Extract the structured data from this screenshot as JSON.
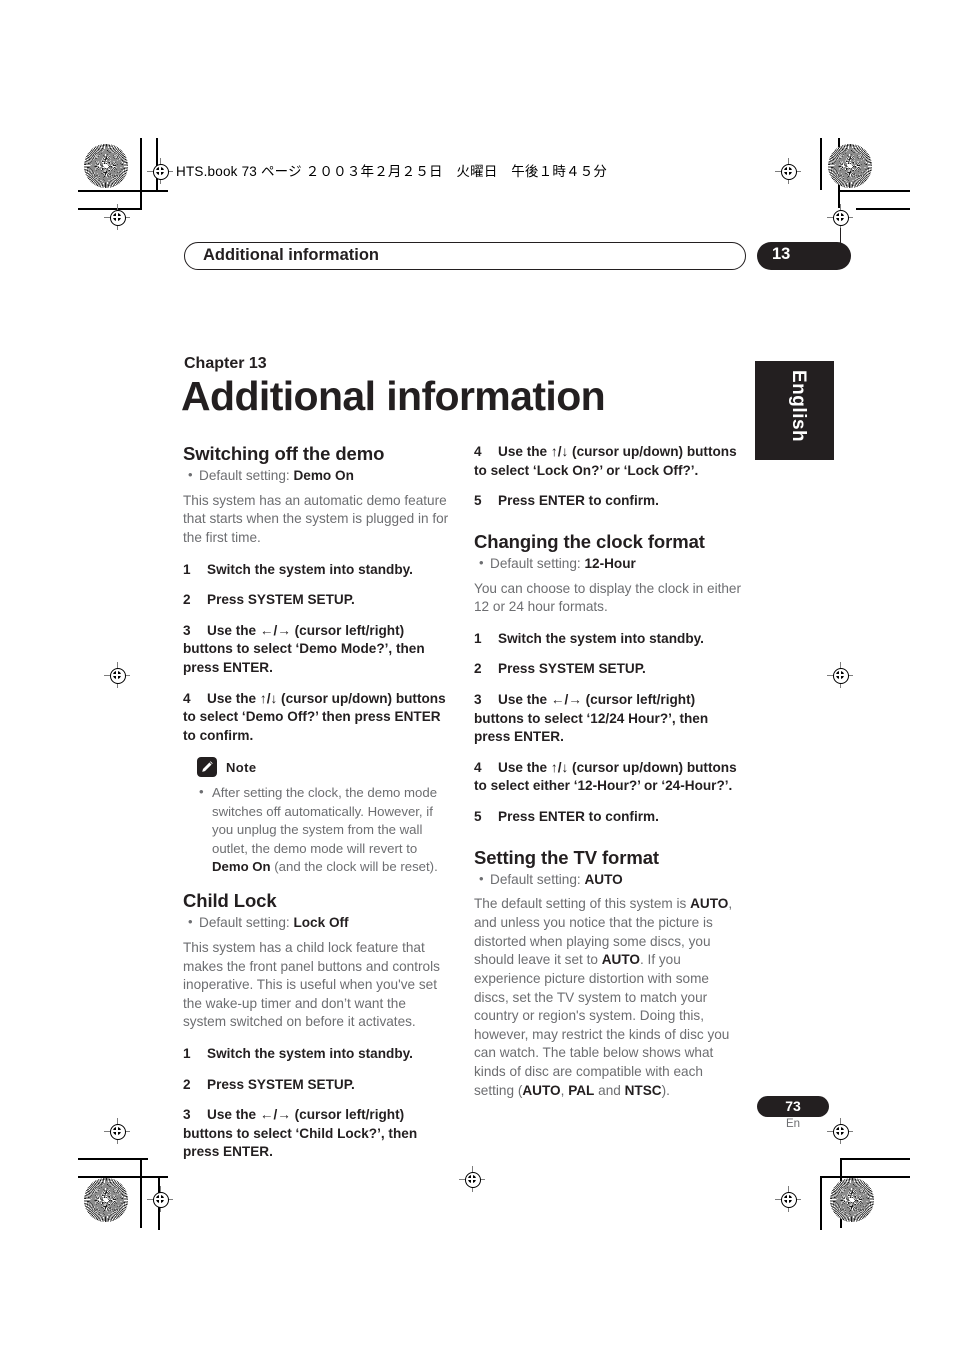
{
  "print_marks": {
    "filename_line": "HTS.book 73 ページ ２００３年２月２５日　火曜日　午後１時４５分"
  },
  "running_head": {
    "title": "Additional information",
    "chapter_number": "13"
  },
  "side_tab": {
    "language": "English"
  },
  "chapter": {
    "label": "Chapter 13",
    "title": "Additional information"
  },
  "left_column": {
    "section1": {
      "heading": "Switching off the demo",
      "default_label": "Default setting: ",
      "default_value": "Demo On",
      "intro": "This system has an automatic demo feature that starts when the system is plugged in for the first time.",
      "steps": [
        {
          "n": "1",
          "text": "Switch the system into standby."
        },
        {
          "n": "2",
          "text": "Press SYSTEM SETUP."
        },
        {
          "n": "3",
          "pre": "Use the ",
          "arrows": "←/→",
          "post": " (cursor left/right) buttons to select ‘Demo Mode?’, then press ENTER."
        },
        {
          "n": "4",
          "pre": "Use the ",
          "arrows": "↑/↓",
          "post": " (cursor up/down) buttons to select ‘Demo Off?’ then press ENTER to confirm."
        }
      ]
    },
    "note": {
      "icon": "pencil-icon",
      "label": "Note",
      "text_part1": "After setting the clock, the demo mode switches off automatically. However, if you unplug the system from the wall outlet, the demo mode will revert to ",
      "text_bold": "Demo On",
      "text_part2": " (and the clock will be reset)."
    },
    "section2": {
      "heading": "Child Lock",
      "default_label": "Default setting: ",
      "default_value": "Lock Off",
      "intro": "This system has a child lock feature that makes the front panel buttons and controls inoperative. This is useful when you've set the wake-up timer and don’t want the system switched on before it activates.",
      "steps": [
        {
          "n": "1",
          "text": "Switch the system into standby."
        },
        {
          "n": "2",
          "text": "Press SYSTEM SETUP."
        },
        {
          "n": "3",
          "pre": "Use the ",
          "arrows": "←/→",
          "post": " (cursor left/right) buttons to select ‘Child Lock?’, then press ENTER."
        }
      ]
    }
  },
  "right_column": {
    "continued_steps": [
      {
        "n": "4",
        "pre": "Use the ",
        "arrows": "↑/↓",
        "post": " (cursor up/down) buttons to select ‘Lock On?’ or ‘Lock Off?’."
      },
      {
        "n": "5",
        "text": "Press ENTER to confirm."
      }
    ],
    "section3": {
      "heading": "Changing the clock format",
      "default_label": "Default setting: ",
      "default_value": "12-Hour",
      "intro": "You can choose to display the clock in either 12 or 24 hour formats.",
      "steps": [
        {
          "n": "1",
          "text": "Switch the system into standby."
        },
        {
          "n": "2",
          "text": "Press SYSTEM SETUP."
        },
        {
          "n": "3",
          "pre": "Use the ",
          "arrows": "←/→",
          "post": " (cursor left/right) buttons to select ‘12/24 Hour?’, then press ENTER."
        },
        {
          "n": "4",
          "pre": "Use the ",
          "arrows": "↑/↓",
          "post": " (cursor up/down) buttons to select either ‘12-Hour?’ or ‘24-Hour?’."
        },
        {
          "n": "5",
          "text": "Press ENTER to confirm."
        }
      ]
    },
    "section4": {
      "heading": "Setting the TV format",
      "default_label": "Default setting: ",
      "default_value": "AUTO",
      "para_a": "The default setting of this system is ",
      "para_b": "AUTO",
      "para_c": ", and unless you notice that the picture is distorted when playing some discs, you should leave it set to ",
      "para_d": "AUTO",
      "para_e": ". If you experience picture distortion with some discs, set the TV system to match your country or region's system. Doing this, however, may restrict the kinds of disc you can watch. The table below shows what kinds of disc are compatible with each setting (",
      "para_f": "AUTO",
      "para_g": ", ",
      "para_h": "PAL",
      "para_i": " and ",
      "para_j": "NTSC",
      "para_k": ")."
    }
  },
  "footer": {
    "page_number": "73",
    "language_code": "En"
  },
  "colors": {
    "ink": "#231f20",
    "body_gray": "#6d6e71",
    "paper": "#ffffff"
  }
}
